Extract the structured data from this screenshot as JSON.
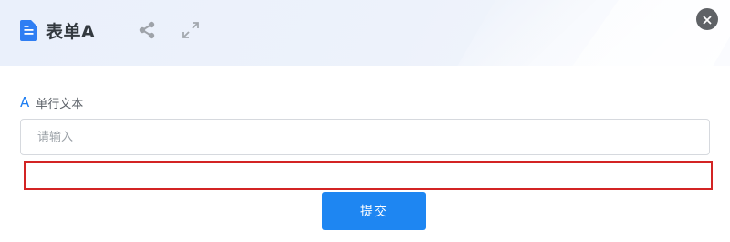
{
  "header": {
    "title": "表单A",
    "icons": [
      "file-icon",
      "share-icon",
      "expand-icon",
      "close-icon"
    ]
  },
  "form": {
    "field": {
      "type_icon": "A",
      "label": "单行文本",
      "placeholder": "请输入",
      "value": ""
    },
    "submit_label": "提交"
  },
  "colors": {
    "accent": "#1e86f2",
    "highlight_border": "#d32424",
    "title_text": "#33393f",
    "close_button": "#5f6266"
  }
}
